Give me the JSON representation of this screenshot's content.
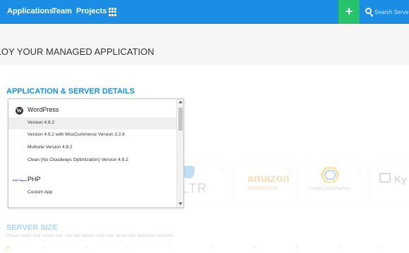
{
  "nav": {
    "items": [
      "Applications",
      "Team",
      "Projects"
    ],
    "add_label": "+",
    "search_placeholder": "Search Server"
  },
  "page": {
    "title": "PLOY YOUR MANAGED APPLICATION",
    "section_title": "APPLICATION & SERVER DETAILS"
  },
  "dropdown": {
    "groups": [
      {
        "label": "WordPress",
        "icon": "wordpress-icon",
        "options": [
          {
            "label": "Version 4.9.2",
            "selected": true
          },
          {
            "label": "Version 4.9.2 with WooCommerce Version 3.2.6",
            "selected": false
          },
          {
            "label": "Multisite Version 4.9.2",
            "selected": false
          },
          {
            "label": "Clean (No Cloudways Optimization) Version 4.9.2",
            "selected": false
          }
        ]
      },
      {
        "label": "PHP",
        "icon": "php-icon",
        "icon_text": "PHP Stack",
        "options": [
          {
            "label": "Custom App",
            "selected": false
          }
        ]
      }
    ]
  },
  "providers": {
    "vultr_text": "LTR",
    "amazon_text": "amazon",
    "amazon_sub": "webservices",
    "gcp_text": "Google Cloud Platform",
    "kyup_text": "Ky"
  },
  "server_size": {
    "title": "SERVER SIZE",
    "hint": "Please select your server size. You can always scale your server size whenever required."
  },
  "colors": {
    "nav_bg": "#1b8de4",
    "accent": "#1b8de4",
    "add_button": "#27c36a"
  }
}
